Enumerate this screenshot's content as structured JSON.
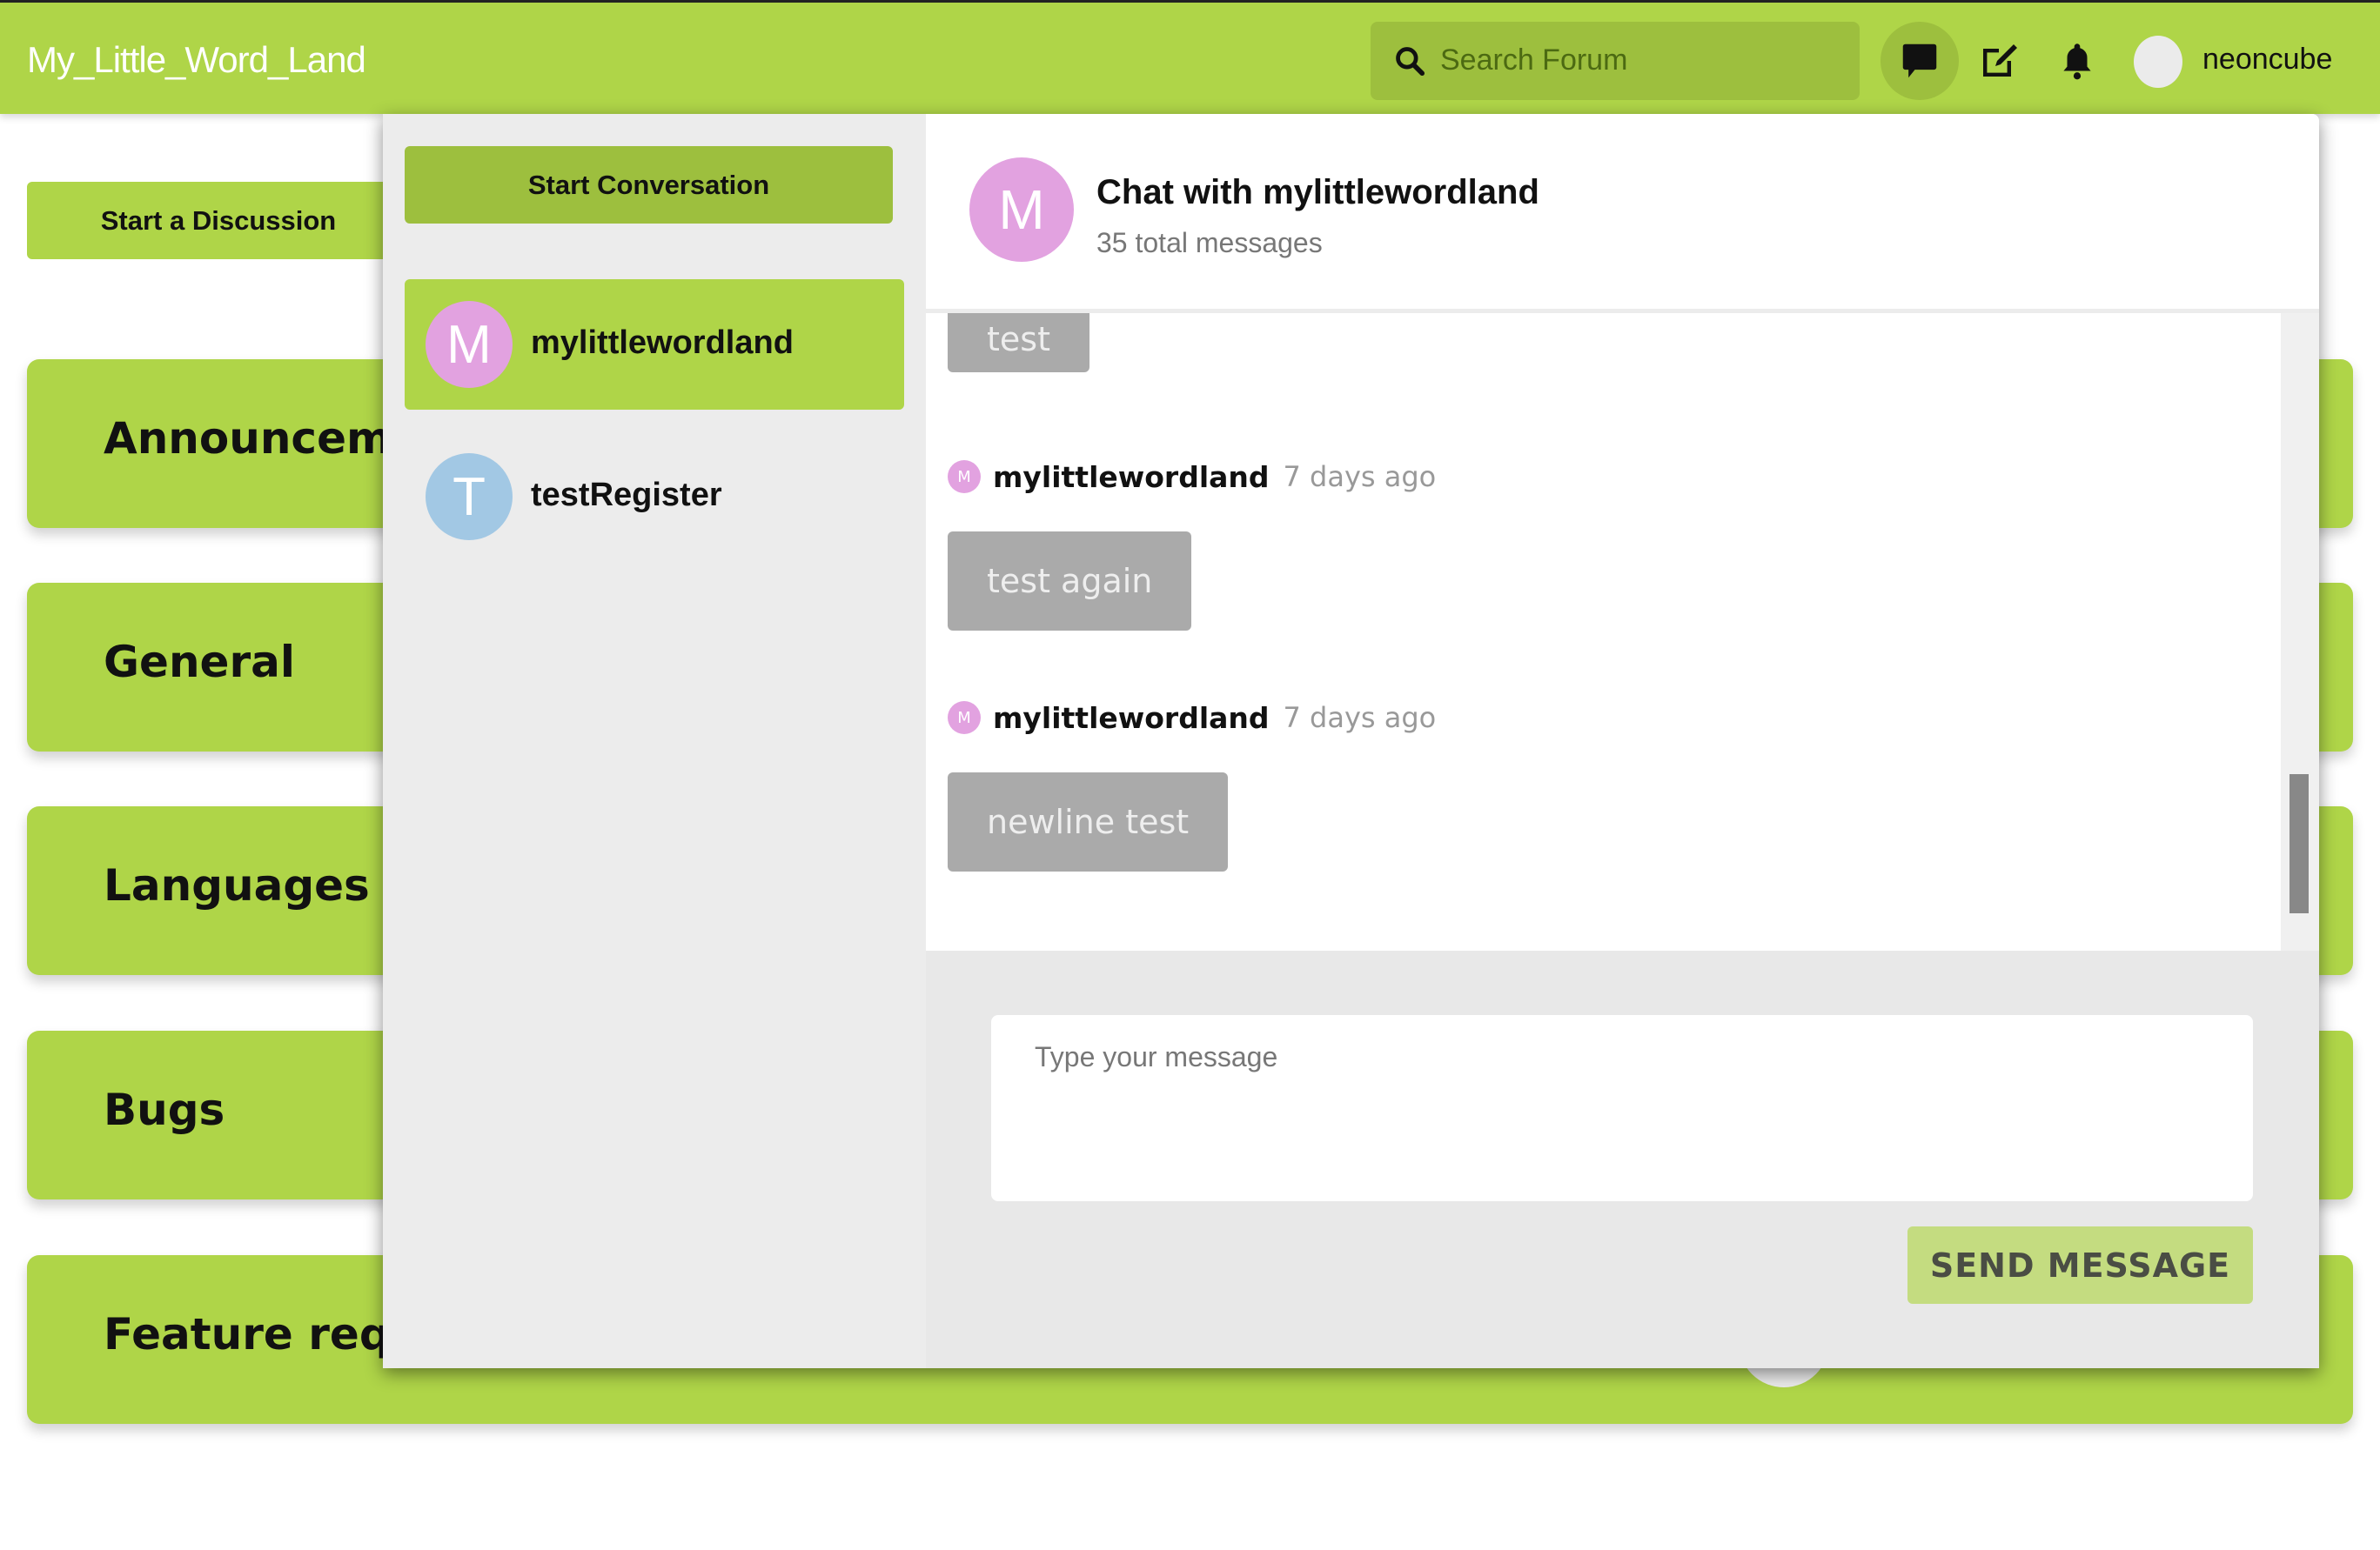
{
  "header": {
    "brand": "My_Little_Word_Land",
    "search_placeholder": "Search Forum",
    "icons": [
      "chat-icon",
      "edit-icon",
      "bell-icon"
    ],
    "username": "neoncube",
    "brand_color": "#AFD548"
  },
  "main": {
    "start_discussion_label": "Start a Discussion",
    "categories": [
      {
        "label": "Announcements"
      },
      {
        "label": "General"
      },
      {
        "label": "Languages"
      },
      {
        "label": "Bugs"
      },
      {
        "label": "Feature requests"
      }
    ]
  },
  "messenger": {
    "start_conversation_label": "Start Conversation",
    "conversations": [
      {
        "initial": "M",
        "name": "mylittlewordland",
        "color": "#E2A2E0",
        "active": true
      },
      {
        "initial": "T",
        "name": "testRegister",
        "color": "#A2C8E4",
        "active": false
      }
    ],
    "chat": {
      "avatar_initial": "M",
      "title": "Chat with mylittlewordland",
      "subtitle": "35 total messages",
      "messages": [
        {
          "sender": "",
          "time": "",
          "text": "test"
        },
        {
          "sender": "mylittlewordland",
          "sender_initial": "M",
          "time": "7 days ago",
          "text": "test again"
        },
        {
          "sender": "mylittlewordland",
          "sender_initial": "M",
          "time": "7 days ago",
          "text": "newline test"
        }
      ],
      "input_placeholder": "Type your message",
      "input_value": "",
      "send_label": "SEND MESSAGE"
    }
  }
}
